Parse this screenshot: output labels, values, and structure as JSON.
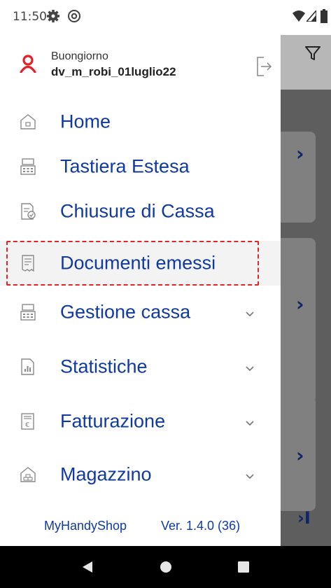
{
  "status_bar": {
    "time": "11:50",
    "icons": [
      "settings-gear-icon",
      "at-sign-icon",
      "wifi-icon",
      "signal-icon",
      "battery-icon"
    ]
  },
  "background_app": {
    "filter_icon": "filter-funnel-icon",
    "chevrons": [
      "›",
      "›",
      "›"
    ],
    "last_page_glyph": "›I"
  },
  "drawer": {
    "user": {
      "greeting": "Buongiorno",
      "username": "dv_m_robi_01luglio22",
      "user_icon": "user-icon",
      "logout_icon": "logout-icon"
    },
    "menu": [
      {
        "label": "Home",
        "icon": "home-icon",
        "expandable": false,
        "selected": false
      },
      {
        "label": "Tastiera Estesa",
        "icon": "cash-register-icon",
        "expandable": false,
        "selected": false
      },
      {
        "label": "Chiusure di Cassa",
        "icon": "closing-document-icon",
        "expandable": false,
        "selected": false
      },
      {
        "label": "Documenti emessi",
        "icon": "receipt-icon",
        "expandable": false,
        "selected": true
      },
      {
        "label": "Gestione cassa",
        "icon": "cash-register-icon",
        "expandable": true,
        "selected": false
      },
      {
        "label": "Statistiche",
        "icon": "statistics-icon",
        "expandable": true,
        "selected": false
      },
      {
        "label": "Fatturazione",
        "icon": "invoice-euro-icon",
        "expandable": true,
        "selected": false
      },
      {
        "label": "Magazzino",
        "icon": "warehouse-icon",
        "expandable": true,
        "selected": false
      }
    ],
    "footer": {
      "app_name": "MyHandyShop",
      "version": "Ver. 1.4.0 (36)"
    }
  },
  "colors": {
    "menu_text": "#113a9e",
    "user_icon": "#e3202a",
    "highlight_border": "#e0262a",
    "scrim": "#5e5e5e"
  },
  "nav_bar": {
    "icons": [
      "back-icon",
      "home-circle-icon",
      "recents-icon"
    ]
  }
}
